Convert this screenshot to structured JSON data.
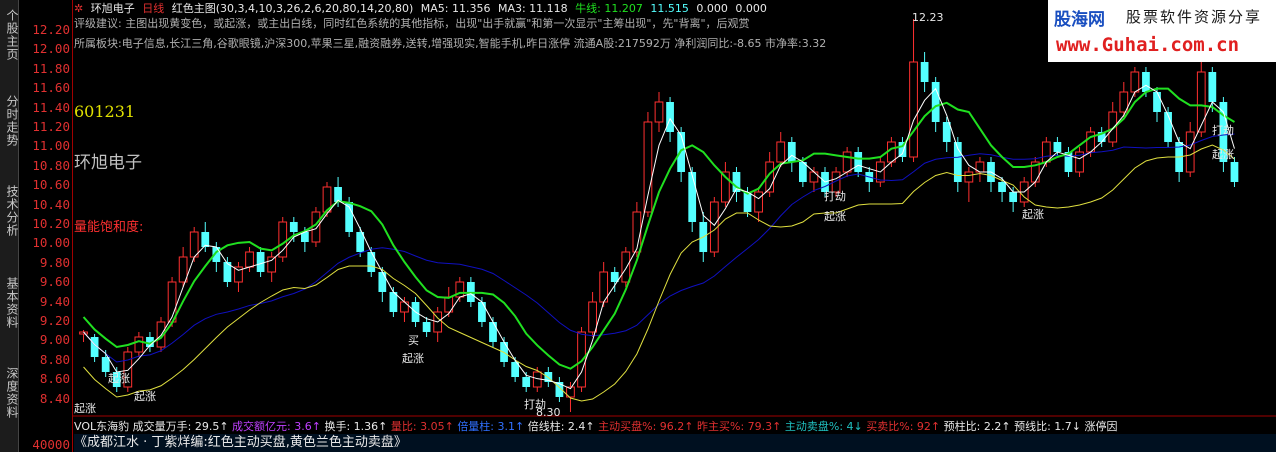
{
  "sidebar": {
    "tabs": [
      "个股主页",
      "分时走势",
      "技术分析",
      "基本资料",
      "深度资料"
    ]
  },
  "axis": {
    "ticks": [
      "12.20",
      "12.00",
      "11.80",
      "11.60",
      "11.40",
      "11.20",
      "11.00",
      "10.80",
      "10.60",
      "10.40",
      "10.20",
      "10.00",
      "9.80",
      "9.60",
      "9.40",
      "9.20",
      "9.00",
      "8.80",
      "8.60",
      "8.40"
    ],
    "vol_tick": "40000"
  },
  "header": {
    "stock_name": "环旭电子",
    "period": "日线",
    "indicator": "红色主图(30,3,4,10,3,26,2,6,20,80,14,20,80)",
    "ma5": "MA5: 11.356",
    "ma3": "MA3: 11.118",
    "bull_line": "牛线: 11.207",
    "bear_line": "11.515",
    "zero1": "0.000",
    "zero2": "0.000"
  },
  "advice": "评级建议: 主图出现黄变色，或起涨，或主出白线，同时红色系统的其他指标，出现\"出手就赢\"和第一次显示\"主筹出现\"，先\"背离\"，后观赏",
  "sector_line": "所属板块:电子信息,长江三角,谷歌眼镜,沪深300,苹果三星,融资融券,送转,增强现实,智能手机,昨日涨停   流通A股:217592万   净利润同比:-8.65   市净率:3.32",
  "stock_code": "601231",
  "stock_label": "环旭电子",
  "saturation_label": "量能饱和度:",
  "annotations": {
    "qizhang": "起涨",
    "dajie": "打劫",
    "mai": "买",
    "high": "12.23",
    "low": "8.30"
  },
  "vol_line": {
    "name": "VOL东海豹",
    "turnover_wan": "成交量万手: 29.5↑",
    "amount_yi": "成交额亿元: 3.6↑",
    "hand_rate": "换手: 1.36↑",
    "vol_ratio": "量比: 3.05↑",
    "double_vol": "倍量柱: 3.1↑",
    "double_line": "倍线柱: 2.4↑",
    "active_buy": "主动买盘%: 96.2↑",
    "yesterday_buy": "昨主买%: 79.3↑",
    "active_sell": "主动卖盘%: 4↓",
    "buy_sell": "买卖比%: 92↑",
    "pillar": "预柱比: 2.2↑",
    "line_ratio": "预线比: 1.7↓",
    "limit": "涨停因"
  },
  "footer": "《成都江水 · 丁紫烊编:红色主动买盘,黄色兰色主动卖盘》",
  "logo": {
    "site_cn": "股海网",
    "slogan": "股票软件资源分享",
    "url": "www.Guhai.com.cn"
  },
  "chart_data": {
    "type": "candlestick",
    "ylim": [
      8.3,
      12.3
    ],
    "candles": [
      [
        9.08,
        9.1,
        9.0,
        9.12
      ],
      [
        9.05,
        8.85,
        8.8,
        9.08
      ],
      [
        8.85,
        8.7,
        8.65,
        8.92
      ],
      [
        8.7,
        8.55,
        8.5,
        8.75
      ],
      [
        8.55,
        8.9,
        8.5,
        8.95
      ],
      [
        8.9,
        9.05,
        8.85,
        9.1
      ],
      [
        9.05,
        8.95,
        8.9,
        9.1
      ],
      [
        8.95,
        9.2,
        8.9,
        9.25
      ],
      [
        9.2,
        9.6,
        9.15,
        9.65
      ],
      [
        9.6,
        9.85,
        9.55,
        9.95
      ],
      [
        9.85,
        10.1,
        9.8,
        10.15
      ],
      [
        10.1,
        9.95,
        9.9,
        10.2
      ],
      [
        9.95,
        9.8,
        9.7,
        10.0
      ],
      [
        9.8,
        9.6,
        9.55,
        9.85
      ],
      [
        9.6,
        9.75,
        9.5,
        9.8
      ],
      [
        9.75,
        9.9,
        9.7,
        9.95
      ],
      [
        9.9,
        9.7,
        9.65,
        9.95
      ],
      [
        9.7,
        9.85,
        9.6,
        9.9
      ],
      [
        9.85,
        10.2,
        9.8,
        10.25
      ],
      [
        10.2,
        10.1,
        10.0,
        10.25
      ],
      [
        10.1,
        10.0,
        9.9,
        10.15
      ],
      [
        10.0,
        10.3,
        9.95,
        10.35
      ],
      [
        10.3,
        10.55,
        10.25,
        10.6
      ],
      [
        10.55,
        10.4,
        10.35,
        10.65
      ],
      [
        10.4,
        10.1,
        10.05,
        10.45
      ],
      [
        10.1,
        9.9,
        9.85,
        10.15
      ],
      [
        9.9,
        9.7,
        9.65,
        9.95
      ],
      [
        9.7,
        9.5,
        9.4,
        9.75
      ],
      [
        9.5,
        9.3,
        9.25,
        9.55
      ],
      [
        9.3,
        9.4,
        9.2,
        9.45
      ],
      [
        9.4,
        9.2,
        9.15,
        9.45
      ],
      [
        9.2,
        9.1,
        9.05,
        9.25
      ],
      [
        9.1,
        9.3,
        9.0,
        9.35
      ],
      [
        9.3,
        9.45,
        9.25,
        9.55
      ],
      [
        9.45,
        9.6,
        9.4,
        9.65
      ],
      [
        9.6,
        9.4,
        9.35,
        9.65
      ],
      [
        9.4,
        9.2,
        9.15,
        9.45
      ],
      [
        9.2,
        9.0,
        8.95,
        9.25
      ],
      [
        9.0,
        8.8,
        8.75,
        9.05
      ],
      [
        8.8,
        8.65,
        8.6,
        8.85
      ],
      [
        8.65,
        8.55,
        8.5,
        8.7
      ],
      [
        8.55,
        8.7,
        8.5,
        8.75
      ],
      [
        8.7,
        8.6,
        8.55,
        8.75
      ],
      [
        8.6,
        8.45,
        8.4,
        8.65
      ],
      [
        8.45,
        8.55,
        8.3,
        8.6
      ],
      [
        8.55,
        9.1,
        8.5,
        9.15
      ],
      [
        9.1,
        9.4,
        9.05,
        9.5
      ],
      [
        9.4,
        9.7,
        9.35,
        9.8
      ],
      [
        9.7,
        9.6,
        9.5,
        9.75
      ],
      [
        9.6,
        9.9,
        9.55,
        9.95
      ],
      [
        9.9,
        10.3,
        9.85,
        10.4
      ],
      [
        10.3,
        11.2,
        10.25,
        11.3
      ],
      [
        11.2,
        11.4,
        11.1,
        11.5
      ],
      [
        11.4,
        11.1,
        11.0,
        11.45
      ],
      [
        11.1,
        10.7,
        10.6,
        11.15
      ],
      [
        10.7,
        10.2,
        10.1,
        10.75
      ],
      [
        10.2,
        9.9,
        9.8,
        10.3
      ],
      [
        9.9,
        10.4,
        9.85,
        10.45
      ],
      [
        10.4,
        10.7,
        10.35,
        10.8
      ],
      [
        10.7,
        10.5,
        10.4,
        10.75
      ],
      [
        10.5,
        10.3,
        10.25,
        10.55
      ],
      [
        10.3,
        10.5,
        10.2,
        10.55
      ],
      [
        10.5,
        10.8,
        10.45,
        10.9
      ],
      [
        10.8,
        11.0,
        10.75,
        11.1
      ],
      [
        11.0,
        10.8,
        10.7,
        11.05
      ],
      [
        10.8,
        10.6,
        10.55,
        10.85
      ],
      [
        10.6,
        10.7,
        10.5,
        10.75
      ],
      [
        10.7,
        10.5,
        10.45,
        10.75
      ],
      [
        10.5,
        10.7,
        10.45,
        10.75
      ],
      [
        10.7,
        10.9,
        10.65,
        10.95
      ],
      [
        10.9,
        10.7,
        10.65,
        10.95
      ],
      [
        10.7,
        10.6,
        10.5,
        10.75
      ],
      [
        10.6,
        10.8,
        10.55,
        10.85
      ],
      [
        10.8,
        11.0,
        10.75,
        11.05
      ],
      [
        11.0,
        10.85,
        10.8,
        11.05
      ],
      [
        10.85,
        11.8,
        10.8,
        12.23
      ],
      [
        11.8,
        11.6,
        11.5,
        11.9
      ],
      [
        11.6,
        11.2,
        11.1,
        11.65
      ],
      [
        11.2,
        11.0,
        10.9,
        11.25
      ],
      [
        11.0,
        10.6,
        10.5,
        11.05
      ],
      [
        10.6,
        10.7,
        10.4,
        10.75
      ],
      [
        10.7,
        10.8,
        10.6,
        10.85
      ],
      [
        10.8,
        10.6,
        10.5,
        10.85
      ],
      [
        10.6,
        10.5,
        10.4,
        10.65
      ],
      [
        10.5,
        10.4,
        10.3,
        10.55
      ],
      [
        10.4,
        10.6,
        10.35,
        10.65
      ],
      [
        10.6,
        10.8,
        10.55,
        10.85
      ],
      [
        10.8,
        11.0,
        10.75,
        11.05
      ],
      [
        11.0,
        10.9,
        10.85,
        11.05
      ],
      [
        10.9,
        10.7,
        10.65,
        10.95
      ],
      [
        10.7,
        10.9,
        10.65,
        10.95
      ],
      [
        10.9,
        11.1,
        10.85,
        11.15
      ],
      [
        11.1,
        11.0,
        10.95,
        11.15
      ],
      [
        11.0,
        11.3,
        10.95,
        11.4
      ],
      [
        11.3,
        11.5,
        11.25,
        11.6
      ],
      [
        11.5,
        11.7,
        11.45,
        11.75
      ],
      [
        11.7,
        11.5,
        11.45,
        11.75
      ],
      [
        11.5,
        11.3,
        11.2,
        11.55
      ],
      [
        11.3,
        11.0,
        10.95,
        11.35
      ],
      [
        11.0,
        10.7,
        10.6,
        11.05
      ],
      [
        10.7,
        11.1,
        10.65,
        11.2
      ],
      [
        11.1,
        11.7,
        11.05,
        11.8
      ],
      [
        11.7,
        11.4,
        11.3,
        11.75
      ],
      [
        11.4,
        10.8,
        10.7,
        11.45
      ],
      [
        10.8,
        10.6,
        10.55,
        10.85
      ]
    ]
  },
  "colors": {
    "up": "#ff3030",
    "down": "#54ffff",
    "ma_white": "#ffffff",
    "ma_blue": "#1010c0",
    "ma_yellow": "#e0e040",
    "ma_green": "#20e020"
  }
}
